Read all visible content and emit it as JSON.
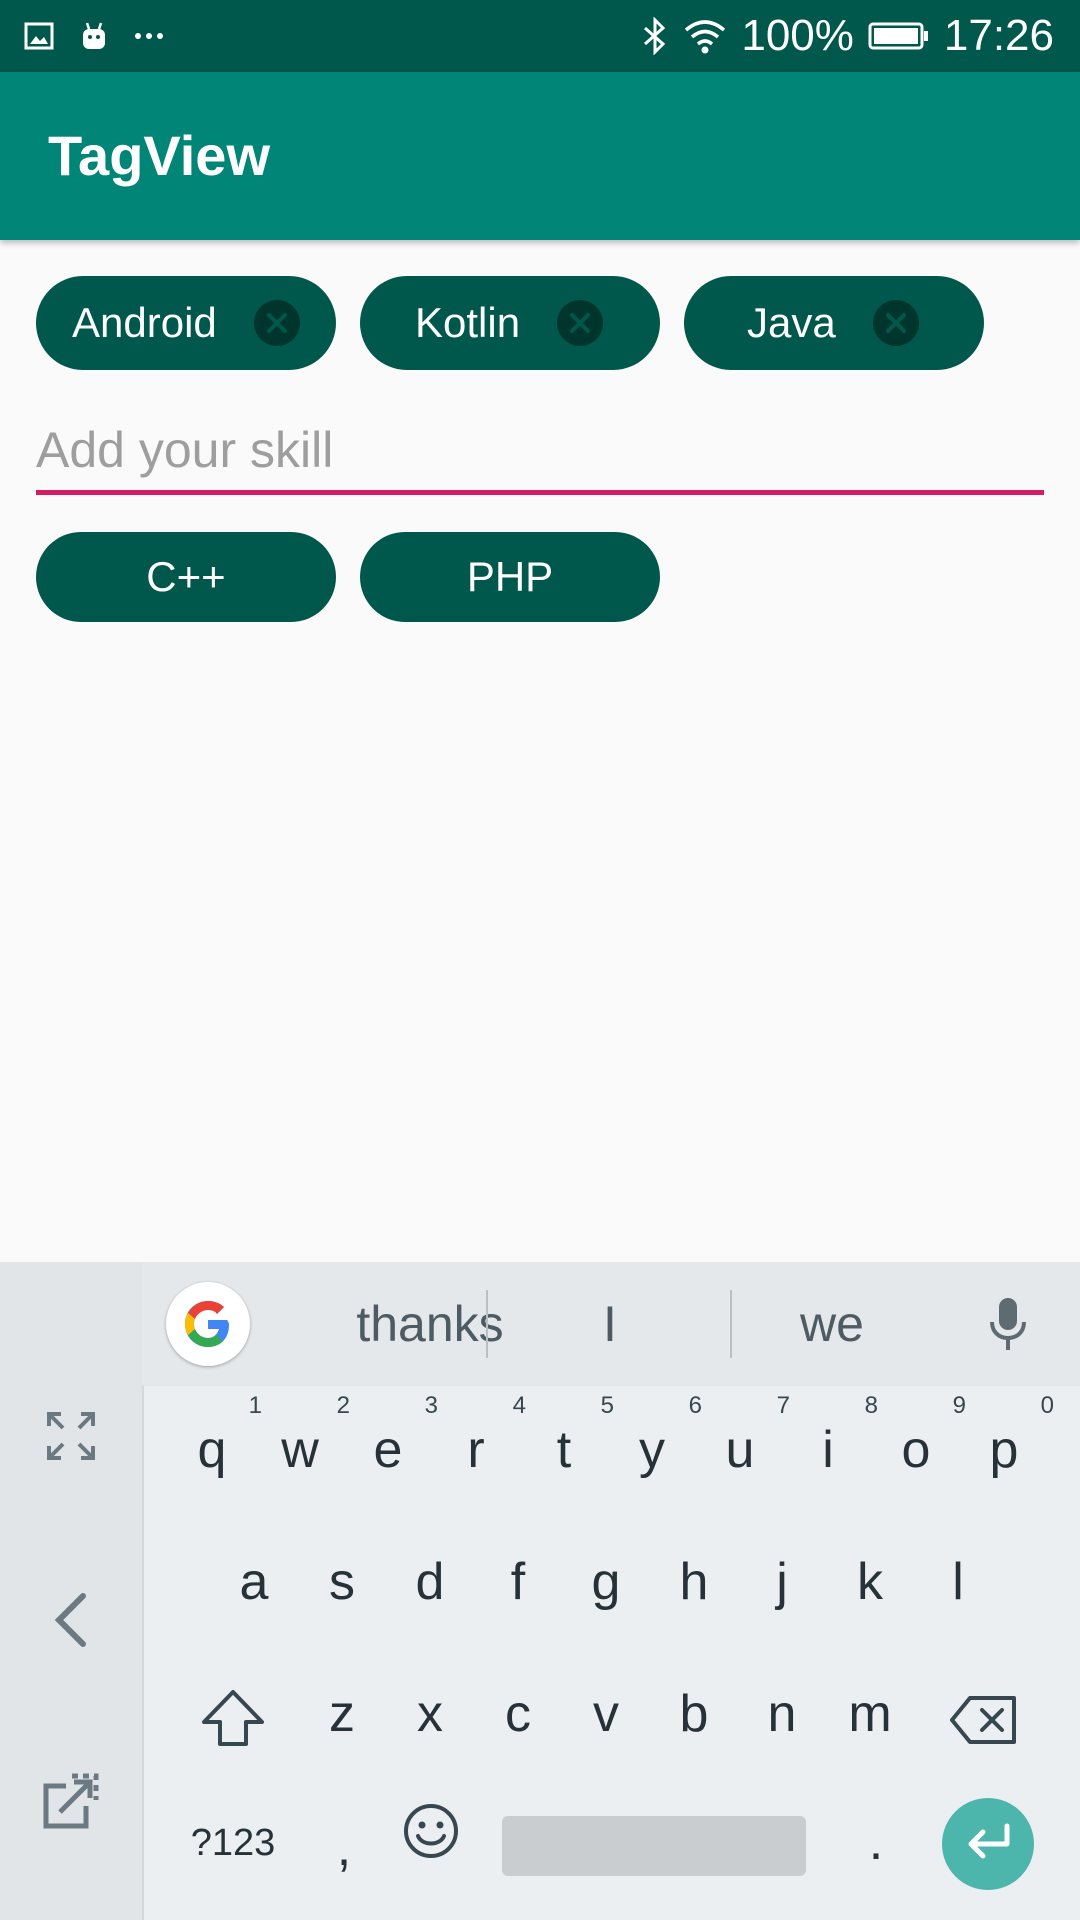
{
  "status_bar": {
    "battery_percent": "100%",
    "time": "17:26",
    "left_icons": [
      "image-icon",
      "android-icon",
      "more-dots-icon"
    ],
    "right_icons": [
      "bluetooth-icon",
      "wifi-icon",
      "battery-icon"
    ]
  },
  "app_bar": {
    "title": "TagView",
    "color": "#008577"
  },
  "selected_tags": [
    {
      "label": "Android"
    },
    {
      "label": "Kotlin"
    },
    {
      "label": "Java"
    }
  ],
  "skill_input": {
    "value": "",
    "placeholder": "Add your skill"
  },
  "suggested_tags": [
    {
      "label": "C++"
    },
    {
      "label": "PHP"
    }
  ],
  "keyboard": {
    "suggestions": [
      "thanks",
      "I",
      "we"
    ],
    "row1": [
      {
        "key": "q",
        "hint": "1"
      },
      {
        "key": "w",
        "hint": "2"
      },
      {
        "key": "e",
        "hint": "3"
      },
      {
        "key": "r",
        "hint": "4"
      },
      {
        "key": "t",
        "hint": "5"
      },
      {
        "key": "y",
        "hint": "6"
      },
      {
        "key": "u",
        "hint": "7"
      },
      {
        "key": "i",
        "hint": "8"
      },
      {
        "key": "o",
        "hint": "9"
      },
      {
        "key": "p",
        "hint": "0"
      }
    ],
    "row2": [
      "a",
      "s",
      "d",
      "f",
      "g",
      "h",
      "j",
      "k",
      "l"
    ],
    "row3": [
      "z",
      "x",
      "c",
      "v",
      "b",
      "n",
      "m"
    ],
    "symbols_key": "?123",
    "comma_key": ",",
    "period_key": ".",
    "accent_color": "#4db6ac"
  },
  "colors": {
    "tag_bg": "#00574b",
    "status_bar": "#00574b",
    "input_underline": "#d81b60"
  }
}
